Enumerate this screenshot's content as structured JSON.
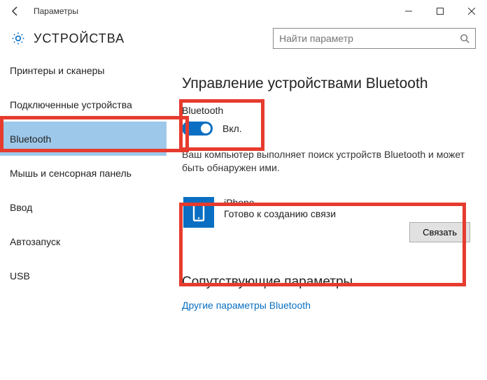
{
  "titlebar": {
    "title": "Параметры"
  },
  "header": {
    "section": "УСТРОЙСТВА",
    "search_placeholder": "Найти параметр"
  },
  "sidebar": {
    "items": [
      {
        "label": "Принтеры и сканеры"
      },
      {
        "label": "Подключенные устройства"
      },
      {
        "label": "Bluetooth"
      },
      {
        "label": "Мышь и сенсорная панель"
      },
      {
        "label": "Ввод"
      },
      {
        "label": "Автозапуск"
      },
      {
        "label": "USB"
      }
    ],
    "selected_index": 2
  },
  "main": {
    "heading": "Управление устройствами Bluetooth",
    "bluetooth_label": "Bluetooth",
    "toggle_state": "Вкл.",
    "description": "Ваш компьютер выполняет поиск устройств Bluetooth и может быть обнаружен ими.",
    "device": {
      "name": "iPhone",
      "status": "Готово к созданию связи",
      "pair_label": "Связать"
    },
    "related_heading": "Сопутствующие параметры",
    "related_link": "Другие параметры Bluetooth"
  }
}
